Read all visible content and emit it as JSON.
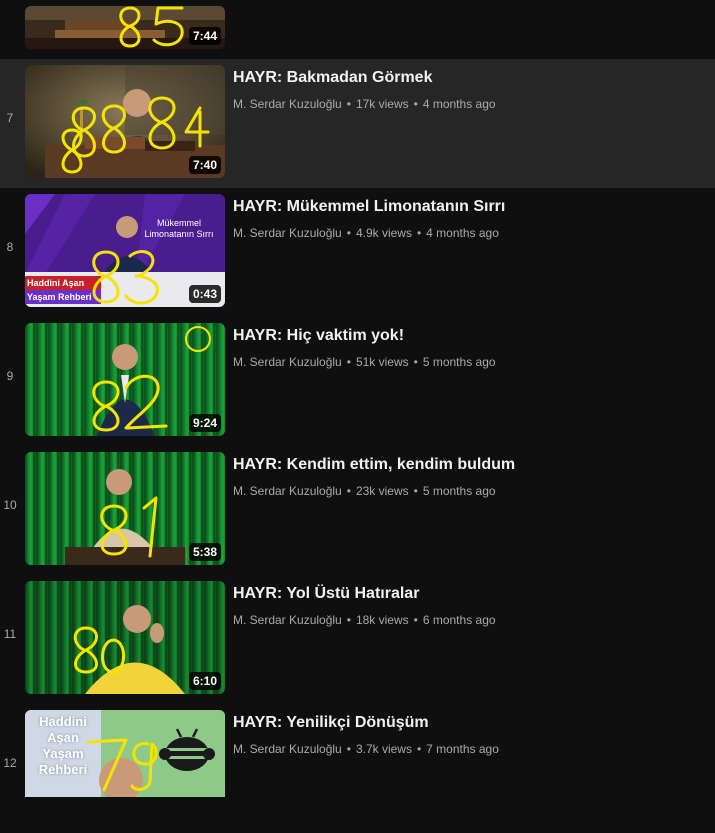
{
  "playlist": {
    "partial_top": {
      "duration": "7:44",
      "scribble_number": "85"
    },
    "items": [
      {
        "index": "7",
        "title": "HAYR: Bakmadan Görmek",
        "channel": "M. Serdar Kuzuloğlu",
        "views": "17k views",
        "age": "4 months ago",
        "duration": "7:40",
        "scribble_number": "884",
        "scribble_number_bottom": "8",
        "thumb_theme": "desk-lamp",
        "active": true
      },
      {
        "index": "8",
        "title": "HAYR: Mükemmel Limonatanın Sırrı",
        "channel": "M. Serdar Kuzuloğlu",
        "views": "4.9k views",
        "age": "4 months ago",
        "duration": "0:43",
        "scribble_number": "83",
        "thumb_text_lines": [
          "Mükemmel",
          "Limonatanın Sırrı"
        ],
        "thumb_badge_lines": [
          "Haddini Aşan",
          "Yaşam Rehberi"
        ],
        "thumb_theme": "purple",
        "active": false
      },
      {
        "index": "9",
        "title": "HAYR: Hiç vaktim yok!",
        "channel": "M. Serdar Kuzuloğlu",
        "views": "51k views",
        "age": "5 months ago",
        "duration": "9:24",
        "scribble_number": "82",
        "thumb_theme": "green-suit",
        "active": false
      },
      {
        "index": "10",
        "title": "HAYR: Kendim ettim, kendim buldum",
        "channel": "M. Serdar Kuzuloğlu",
        "views": "23k views",
        "age": "5 months ago",
        "duration": "5:38",
        "scribble_number": "81",
        "thumb_theme": "green-beige",
        "active": false
      },
      {
        "index": "11",
        "title": "HAYR: Yol Üstü Hatıralar",
        "channel": "M. Serdar Kuzuloğlu",
        "views": "18k views",
        "age": "6 months ago",
        "duration": "6:10",
        "scribble_number": "80",
        "thumb_theme": "green-yellow",
        "active": false
      },
      {
        "index": "12",
        "title": "HAYR: Yenilikçi Dönüşüm",
        "channel": "M. Serdar Kuzuloğlu",
        "views": "3.7k views",
        "age": "7 months ago",
        "duration": "",
        "scribble_number": "79",
        "thumb_text_lines": [
          "Haddini",
          "Aşan",
          "Yaşam",
          "Rehberi"
        ],
        "thumb_theme": "bee",
        "active": false
      }
    ]
  },
  "colors": {
    "background": "#0f0f0f",
    "active_row": "#262626",
    "scribble": "#f5e400",
    "meta_text": "#aaaaaa"
  }
}
